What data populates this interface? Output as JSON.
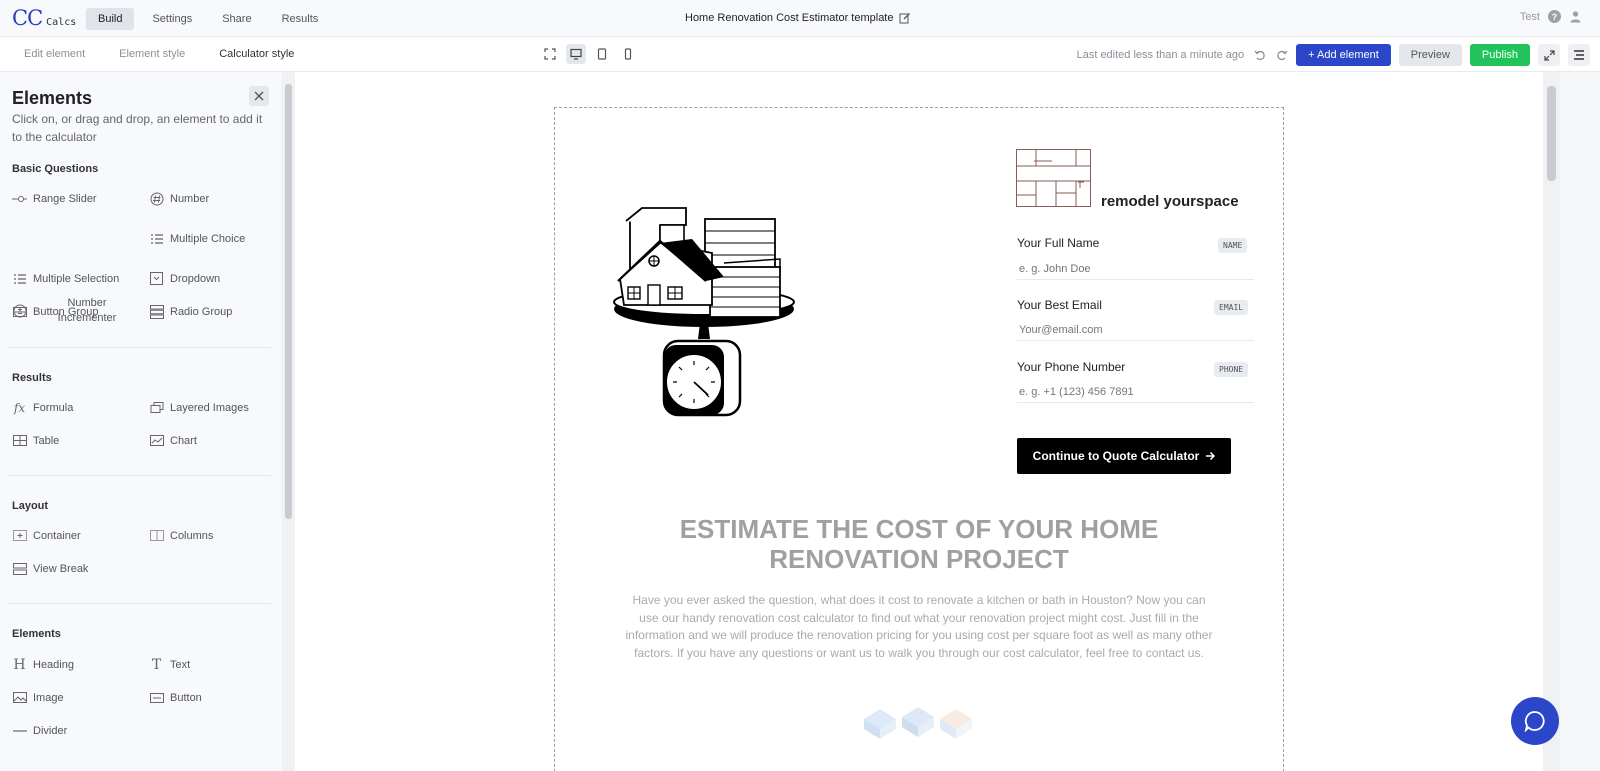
{
  "app": {
    "logo_cc": "CC",
    "logo_calcs": "Calcs",
    "nav_tabs": [
      "Build",
      "Settings",
      "Share",
      "Results"
    ],
    "title": "Home Renovation Cost Estimator template",
    "user_label": "Test"
  },
  "toolbar": {
    "subtabs": [
      "Edit element",
      "Element style",
      "Calculator style"
    ],
    "last_edited": "Last edited less than a minute ago",
    "add_element": "+ Add element",
    "preview": "Preview",
    "publish": "Publish"
  },
  "sidebar": {
    "title": "Elements",
    "subtitle": "Click on, or drag and drop, an element to add it to the calculator",
    "sections": {
      "basic": {
        "title": "Basic Questions",
        "items": [
          "Range Slider",
          "Number",
          "Number Incrementer",
          "Multiple Choice",
          "Multiple Selection",
          "Dropdown",
          "Button Group",
          "Radio Group"
        ]
      },
      "results": {
        "title": "Results",
        "items": [
          "Formula",
          "Layered Images",
          "Table",
          "Chart"
        ]
      },
      "layout": {
        "title": "Layout",
        "items": [
          "Container",
          "Columns",
          "View Break"
        ]
      },
      "elements": {
        "title": "Elements",
        "items": [
          "Heading",
          "Text",
          "Image",
          "Button",
          "Divider"
        ]
      }
    }
  },
  "form": {
    "brand": "remodel yourspace",
    "fields": [
      {
        "label": "Your Full Name",
        "tag": "NAME",
        "placeholder": "e. g. John Doe"
      },
      {
        "label": "Your Best Email",
        "tag": "EMAIL",
        "placeholder": "Your@email.com"
      },
      {
        "label": "Your Phone Number",
        "tag": "PHONE",
        "placeholder": "e. g. +1 (123) 456 7891"
      }
    ],
    "cta": "Continue to Quote Calculator"
  },
  "content": {
    "title": "ESTIMATE THE COST OF YOUR HOME RENOVATION PROJECT",
    "description": "Have you ever asked the question, what does it cost to renovate a kitchen or bath in Houston? Now you can use our handy renovation cost calculator to find out what your renovation project might cost. Just fill in the information and we will produce the renovation pricing for you using cost per square foot as well as many other factors. If you have any questions or want us to walk you through our cost calculator, feel free to contact us."
  },
  "colors": {
    "brand_blue": "#2c46c9",
    "publish_green": "#20c45a"
  }
}
